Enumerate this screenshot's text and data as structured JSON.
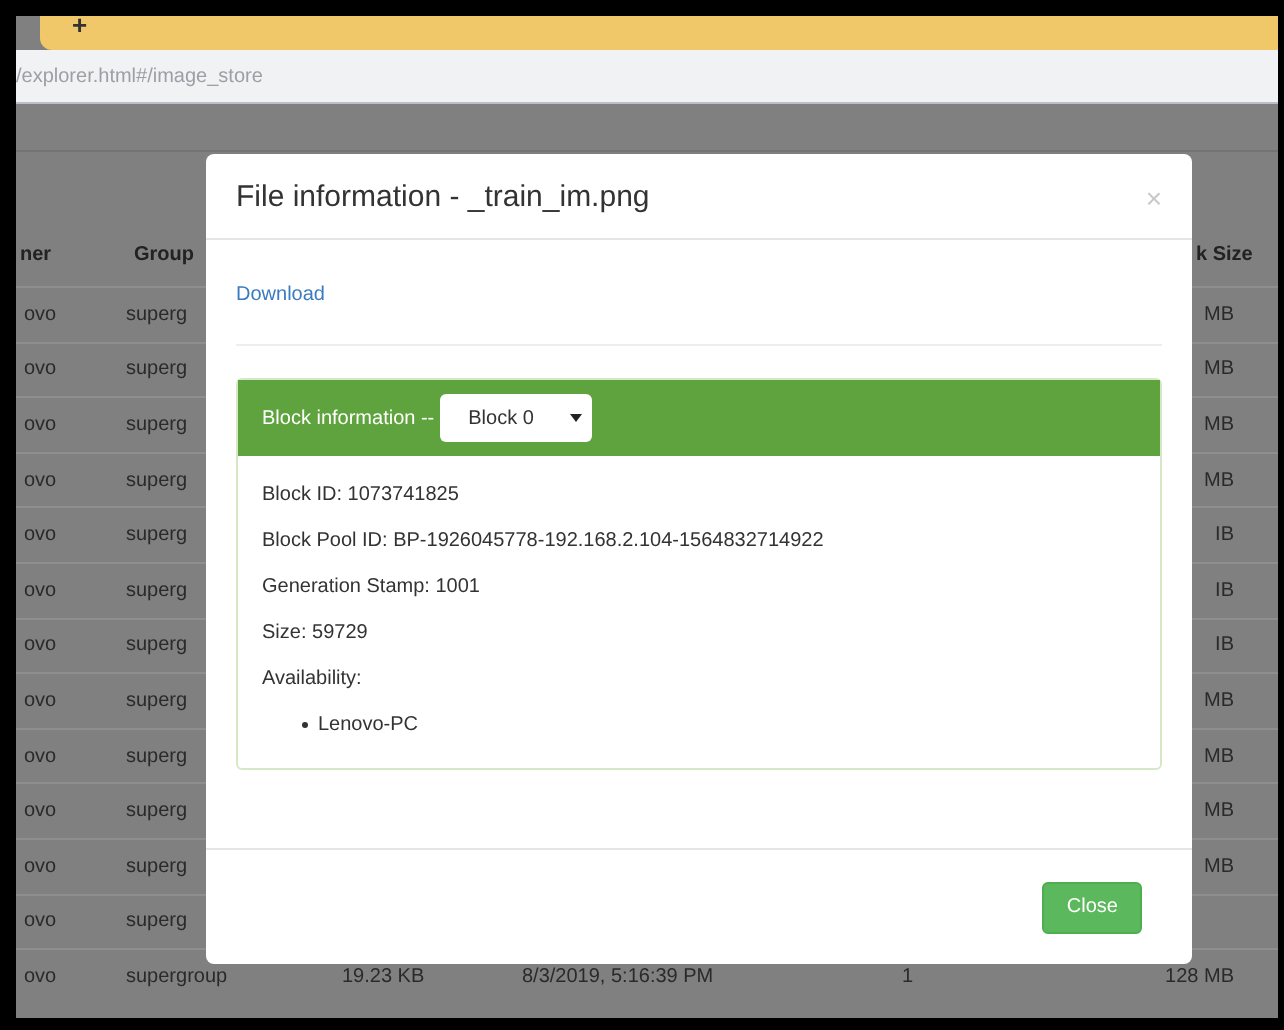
{
  "browser": {
    "new_tab_button": "+",
    "address": "/explorer.html#/image_store"
  },
  "table": {
    "columns": [
      {
        "label": "ner"
      },
      {
        "label": "Group"
      },
      {
        "label": "k Size"
      }
    ],
    "rows": [
      {
        "column_1": "ovo",
        "column_2": "superg",
        "column_6": "MB"
      },
      {
        "column_1": "ovo",
        "column_2": "superg",
        "column_6": "MB"
      },
      {
        "column_1": "ovo",
        "column_2": "superg",
        "column_6": "MB"
      },
      {
        "column_1": "ovo",
        "column_2": "superg",
        "column_6": "MB"
      },
      {
        "column_1": "ovo",
        "column_2": "superg",
        "column_6": "IB"
      },
      {
        "column_1": "ovo",
        "column_2": "superg",
        "column_6": "IB"
      },
      {
        "column_1": "ovo",
        "column_2": "superg",
        "column_6": "IB"
      },
      {
        "column_1": "ovo",
        "column_2": "superg",
        "column_6": "MB"
      },
      {
        "column_1": "ovo",
        "column_2": "superg",
        "column_6": "MB"
      },
      {
        "column_1": "ovo",
        "column_2": "superg",
        "column_6": "MB"
      },
      {
        "column_1": "ovo",
        "column_2": "superg",
        "column_6": "MB"
      },
      {
        "column_1": "ovo",
        "column_2": "superg"
      },
      {
        "column_1": "ovo",
        "column_2": "supergroup",
        "column_3": "19.23 KB",
        "column_4": "8/3/2019, 5:16:39 PM",
        "column_5": "1",
        "column_6": "128 MB"
      }
    ]
  },
  "dialog": {
    "title": "File information - _train_im.png",
    "close_icon": "×",
    "download_link": "Download",
    "panel": {
      "heading": "Block information --",
      "block_select": "Block 0",
      "lines": [
        "Block ID: 1073741825",
        "Block Pool ID: BP-1926045778-192.168.2.104-1564832714922",
        "Generation Stamp: 1001",
        "Size: 59729",
        "Availability:"
      ],
      "hosts": [
        "Lenovo-PC"
      ]
    },
    "close_button": "Close"
  }
}
